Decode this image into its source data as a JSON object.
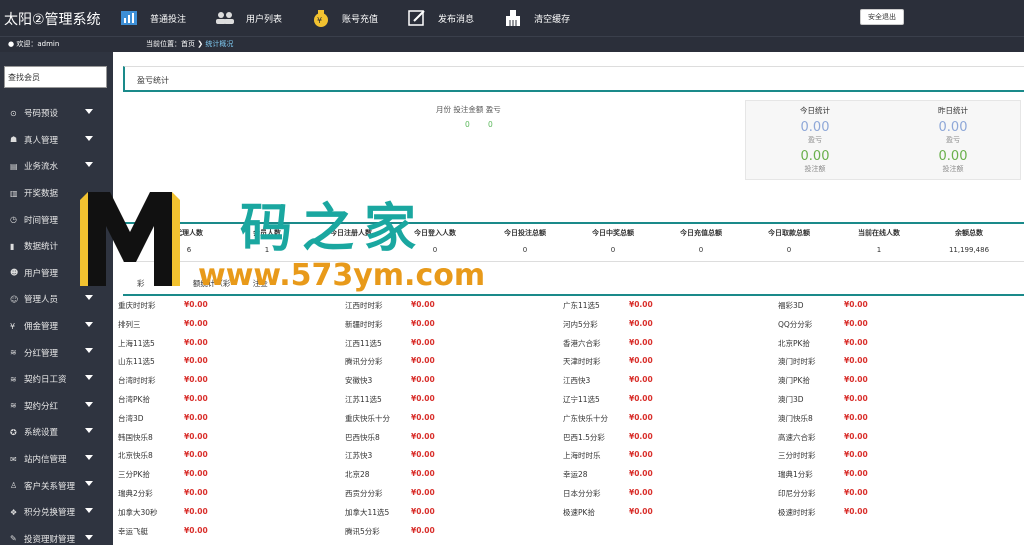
{
  "header": {
    "brand": "太阳②管理系统",
    "nav": [
      {
        "label": "普通投注",
        "icon": "chart-icon"
      },
      {
        "label": "用户列表",
        "icon": "users-icon"
      },
      {
        "label": "账号充值",
        "icon": "money-bag-icon"
      },
      {
        "label": "发布消息",
        "icon": "edit-icon"
      },
      {
        "label": "清空缓存",
        "icon": "clear-cache-icon"
      }
    ],
    "logout": "安全退出"
  },
  "subbar": {
    "welcome": "欢迎：admin",
    "crumb_label": "当前位置：首页",
    "crumb_current": "统计概况"
  },
  "sidebar": {
    "search_value": "查找会员",
    "items": [
      {
        "label": "号码预设",
        "icon": "gear-icon"
      },
      {
        "label": "真人管理",
        "icon": "user-icon"
      },
      {
        "label": "业务流水",
        "icon": "list-icon"
      },
      {
        "label": "开奖数据",
        "icon": "bar-icon"
      },
      {
        "label": "时间管理",
        "icon": "clock-icon"
      },
      {
        "label": "数据统计",
        "icon": "stats-icon"
      },
      {
        "label": "用户管理",
        "icon": "users-icon"
      },
      {
        "label": "管理人员",
        "icon": "admin-icon"
      },
      {
        "label": "佣金管理",
        "icon": "yen-icon"
      },
      {
        "label": "分红管理",
        "icon": "database-icon"
      },
      {
        "label": "契约日工资",
        "icon": "database-icon"
      },
      {
        "label": "契约分红",
        "icon": "database-icon"
      },
      {
        "label": "系统设置",
        "icon": "settings-icon"
      },
      {
        "label": "站内信管理",
        "icon": "mail-icon"
      },
      {
        "label": "客户关系管理",
        "icon": "person-icon"
      },
      {
        "label": "积分兑换管理",
        "icon": "gift-icon"
      },
      {
        "label": "投资理财管理",
        "icon": "edit-icon"
      }
    ]
  },
  "profit": {
    "title": "盈亏统计",
    "month_head": "月份 投注金额 盈亏",
    "val1": "0",
    "val2": "0",
    "today_head": "今日统计",
    "yesterday_head": "昨日统计",
    "today_profit": "0.00",
    "today_profit_label": "盈亏",
    "today_bet": "0.00",
    "today_bet_label": "投注额",
    "yest_profit": "0.00",
    "yest_profit_label": "盈亏",
    "yest_bet": "0.00",
    "yest_bet_label": "投注额"
  },
  "stats": {
    "title": "ti",
    "headers": [
      "代理人数",
      "会员人数",
      "今日注册人数",
      "今日登入人数",
      "今日投注总额",
      "今日中奖总额",
      "今日充值总额",
      "今日取款总额",
      "当前在线人数",
      "余额总数"
    ],
    "values": [
      "6",
      "1",
      "",
      "0",
      "0",
      "0",
      "0",
      "0",
      "1",
      "11,199,486"
    ]
  },
  "lottery": {
    "title": "彩",
    "title_suffix": "额统计（彩",
    "title_tail": "注金",
    "columns": [
      [
        {
          "name": "重庆时时彩",
          "val": "¥0.00"
        },
        {
          "name": "排列三",
          "val": "¥0.00"
        },
        {
          "name": "上海11选5",
          "val": "¥0.00"
        },
        {
          "name": "山东11选5",
          "val": "¥0.00"
        },
        {
          "name": "台湾时时彩",
          "val": "¥0.00"
        },
        {
          "name": "台湾PK拾",
          "val": "¥0.00"
        },
        {
          "name": "台湾3D",
          "val": "¥0.00"
        },
        {
          "name": "韩国快乐8",
          "val": "¥0.00"
        },
        {
          "name": "北京快乐8",
          "val": "¥0.00"
        },
        {
          "name": "三分PK拾",
          "val": "¥0.00"
        },
        {
          "name": "瑞典2分彩",
          "val": "¥0.00"
        },
        {
          "name": "加拿大30秒",
          "val": "¥0.00"
        },
        {
          "name": "幸运飞艇",
          "val": "¥0.00"
        }
      ],
      [
        {
          "name": "江西时时彩",
          "val": "¥0.00"
        },
        {
          "name": "新疆时时彩",
          "val": "¥0.00"
        },
        {
          "name": "江西11选5",
          "val": "¥0.00"
        },
        {
          "name": "腾讯分分彩",
          "val": "¥0.00"
        },
        {
          "name": "安徽快3",
          "val": "¥0.00"
        },
        {
          "name": "江苏11选5",
          "val": "¥0.00"
        },
        {
          "name": "重庆快乐十分",
          "val": "¥0.00"
        },
        {
          "name": "巴西快乐8",
          "val": "¥0.00"
        },
        {
          "name": "江苏快3",
          "val": "¥0.00"
        },
        {
          "name": "北京28",
          "val": "¥0.00"
        },
        {
          "name": "西贡分分彩",
          "val": "¥0.00"
        },
        {
          "name": "加拿大11选5",
          "val": "¥0.00"
        },
        {
          "name": "腾讯5分彩",
          "val": "¥0.00"
        }
      ],
      [
        {
          "name": "广东11选5",
          "val": "¥0.00"
        },
        {
          "name": "河内5分彩",
          "val": "¥0.00"
        },
        {
          "name": "香港六合彩",
          "val": "¥0.00"
        },
        {
          "name": "天津时时彩",
          "val": "¥0.00"
        },
        {
          "name": "江西快3",
          "val": "¥0.00"
        },
        {
          "name": "辽宁11选5",
          "val": "¥0.00"
        },
        {
          "name": "广东快乐十分",
          "val": "¥0.00"
        },
        {
          "name": "巴西1.5分彩",
          "val": "¥0.00"
        },
        {
          "name": "上海时时乐",
          "val": "¥0.00"
        },
        {
          "name": "幸运28",
          "val": "¥0.00"
        },
        {
          "name": "日本分分彩",
          "val": "¥0.00"
        },
        {
          "name": "极速PK拾",
          "val": "¥0.00"
        }
      ],
      [
        {
          "name": "福彩3D",
          "val": "¥0.00"
        },
        {
          "name": "QQ分分彩",
          "val": "¥0.00"
        },
        {
          "name": "北京PK拾",
          "val": "¥0.00"
        },
        {
          "name": "澳门时时彩",
          "val": "¥0.00"
        },
        {
          "name": "澳门PK拾",
          "val": "¥0.00"
        },
        {
          "name": "澳门3D",
          "val": "¥0.00"
        },
        {
          "name": "澳门快乐8",
          "val": "¥0.00"
        },
        {
          "name": "高速六合彩",
          "val": "¥0.00"
        },
        {
          "name": "三分时时彩",
          "val": "¥0.00"
        },
        {
          "name": "瑞典1分彩",
          "val": "¥0.00"
        },
        {
          "name": "印尼分分彩",
          "val": "¥0.00"
        },
        {
          "name": "极速时时彩",
          "val": "¥0.00"
        }
      ]
    ]
  },
  "watermark": {
    "line1": "码之家",
    "line2": "www.573ym.com"
  }
}
